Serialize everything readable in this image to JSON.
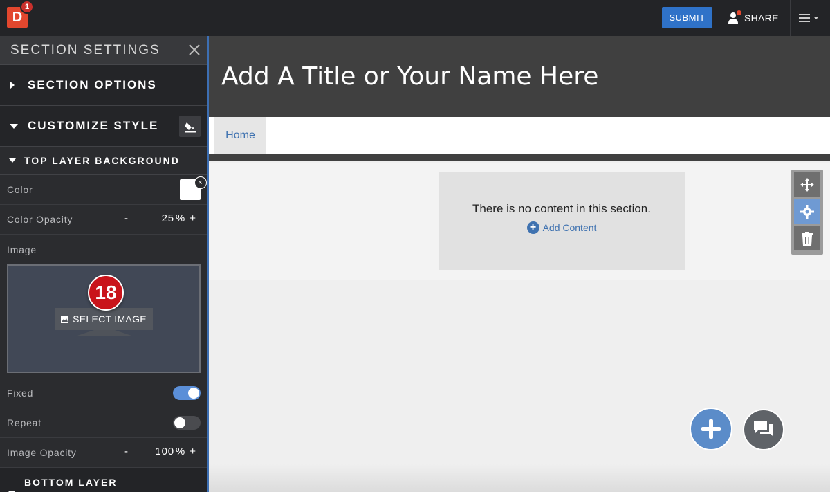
{
  "topbar": {
    "logo_letter": "D",
    "notification_count": "1",
    "submit_label": "SUBMIT",
    "share_label": "SHARE"
  },
  "sidebar": {
    "title": "SECTION SETTINGS",
    "section_options_label": "SECTION OPTIONS",
    "customize_style_label": "CUSTOMIZE STYLE",
    "top_layer_label": "TOP LAYER BACKGROUND",
    "color_label": "Color",
    "color_value": "#ffffff",
    "color_opacity_label": "Color Opacity",
    "color_opacity_value": "25",
    "image_label": "Image",
    "select_image_label": "SELECT IMAGE",
    "step_badge": "18",
    "fixed_label": "Fixed",
    "fixed_on": true,
    "repeat_label": "Repeat",
    "repeat_on": false,
    "image_opacity_label": "Image Opacity",
    "image_opacity_value": "100",
    "bottom_layer_label": "BOTTOM LAYER",
    "percent_sign": "%",
    "minus_sign": "-",
    "plus_sign": "+",
    "clear_glyph": "×"
  },
  "main": {
    "site_title": "Add A Title or Your Name Here",
    "nav_items": [
      "Home"
    ],
    "empty_message": "There is no content in this section.",
    "add_content_label": "Add Content"
  },
  "colors": {
    "accent_blue": "#2f72c8",
    "link_blue": "#3f72b0",
    "logo_red": "#e2472e",
    "badge_red": "#c9141b"
  },
  "icons": [
    "menu-icon",
    "person-icon",
    "close-icon",
    "paint-bucket-icon",
    "image-icon",
    "move-icon",
    "gear-icon",
    "trash-icon",
    "plus-circle-icon",
    "chat-icon"
  ]
}
